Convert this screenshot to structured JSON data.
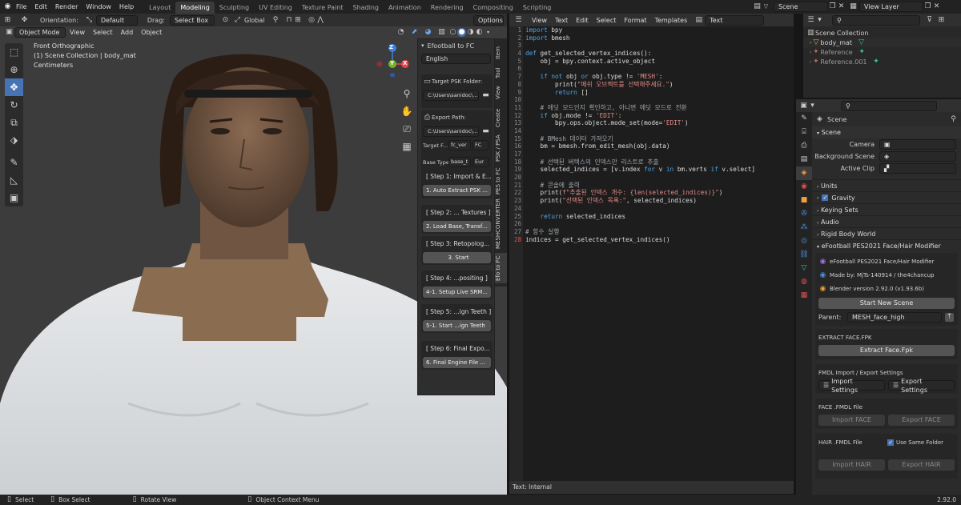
{
  "topbar": {
    "menus": [
      "File",
      "Edit",
      "Render",
      "Window",
      "Help"
    ],
    "workspaces": [
      "Layout",
      "Modeling",
      "Sculpting",
      "UV Editing",
      "Texture Paint",
      "Shading",
      "Animation",
      "Rendering",
      "Compositing",
      "Scripting"
    ],
    "active_workspace": "Modeling",
    "scene_label": "Scene",
    "view_layer_label": "View Layer"
  },
  "viewport": {
    "orientation_label": "Orientation:",
    "orientation_value": "Default",
    "drag_label": "Drag:",
    "drag_value": "Select Box",
    "transform_value": "Global",
    "options_label": "Options",
    "mode": "Object Mode",
    "menus": [
      "View",
      "Select",
      "Add",
      "Object"
    ],
    "info_line1": "Front Orthographic",
    "info_line2": "(1) Scene Collection | body_mat",
    "info_line3": "Centimeters",
    "gizmo_z": "Z",
    "gizmo_x": "X",
    "gizmo_y": "Y"
  },
  "npanel": {
    "title": "Efootball to FC",
    "language": "English",
    "target_psk_label": "Target PSK Folder:",
    "target_psk_value": "C:\\Users\\sanidoc\\...",
    "export_path_label": "Export Path:",
    "export_path_value": "C:\\Users\\sanidoc\\...",
    "target_f_label": "Target F...",
    "target_f_value": "fc_ver",
    "target_f_value2": "FC",
    "base_type_label": "Base Type:",
    "base_type_value": "base_t",
    "base_type_value2": "Eur",
    "steps": [
      {
        "label": "[ Step 1: Import & E...",
        "button": "1. Auto Extract PSK ..."
      },
      {
        "label": "[ Step 2: ... Textures ]",
        "button": "2. Load Base, Transf..."
      },
      {
        "label": "[ Step 3: Retopolog...",
        "button": "3. Start"
      },
      {
        "label": "[ Step 4: ...positing ]",
        "button": "4-1. Setup Live SRM..."
      },
      {
        "label": "[ Step 5: ...ign Teeth ]",
        "button": "5-1. Start ...ign Teeth"
      },
      {
        "label": "[ Step 6: Final Expo...",
        "button": "6. Final Engine File ..."
      }
    ],
    "tabs": [
      "Item",
      "Tool",
      "View",
      "Create",
      "PSK / PSA",
      "PES to FC",
      "MESHCONVERTER",
      "Efo to FC"
    ]
  },
  "texteditor": {
    "menus": [
      "View",
      "Text",
      "Edit",
      "Select",
      "Format",
      "Templates"
    ],
    "file_name": "Text",
    "footer": "Text: Internal",
    "line_count": 28,
    "lines": [
      "import bpy",
      "import bmesh",
      "",
      "def get_selected_vertex_indices():",
      "    obj = bpy.context.active_object",
      "",
      "    if not obj or obj.type != 'MESH':",
      "        print(\"메쉬 오브젝트를 선택해주세요.\")",
      "        return []",
      "",
      "    # 에딧 모드인지 확인하고, 아니면 에딧 모드로 전환",
      "    if obj.mode != 'EDIT':",
      "        bpy.ops.object.mode_set(mode='EDIT')",
      "",
      "    # BMesh 데이터 가져오기",
      "    bm = bmesh.from_edit_mesh(obj.data)",
      "",
      "    # 선택된 버텍스의 인덱스만 리스트로 추출",
      "    selected_indices = [v.index for v in bm.verts if v.select]",
      "",
      "    # 콘솔에 출력",
      "    print(f\"추출된 인덱스 개수: {len(selected_indices)}\")",
      "    print(\"선택된 인덱스 목록:\", selected_indices)",
      "",
      "    return selected_indices",
      "",
      "# 함수 실행",
      "indices = get_selected_vertex_indices()"
    ]
  },
  "outliner": {
    "root": "Scene Collection",
    "items": [
      "body_mat",
      "Reference",
      "Reference.001"
    ]
  },
  "properties": {
    "scene_name": "Scene",
    "scene_section": "Scene",
    "camera_label": "Camera",
    "background_label": "Background Scene",
    "clip_label": "Active Clip",
    "sections": [
      "Units",
      "Gravity",
      "Keying Sets",
      "Audio",
      "Rigid Body World"
    ],
    "addon_title": "eFootball PES2021 Face/Hair Modifier",
    "addon_name": "eFootball PES2021 Face/Hair Modifier",
    "made_by": "Made by: MjTs-140914 / the4chancup",
    "blender_version": "Blender version 2.92.0 (v1.93.6b)",
    "start_new_scene": "Start New Scene",
    "parent_label": "Parent:",
    "parent_value": "MESH_face_high",
    "extract_face_header": "EXTRACT FACE.FPK",
    "extract_face_button": "Extract Face.Fpk",
    "fmdl_header": "FMDL Import / Export Settings",
    "import_settings": "Import Settings",
    "export_settings": "Export Settings",
    "face_fmdl_header": "FACE .FMDL File",
    "import_face": "Import FACE",
    "export_face": "Export FACE",
    "hair_fmdl_header": "HAIR .FMDL File",
    "use_same_folder": "Use Same Folder",
    "import_hair": "Import HAIR",
    "export_hair": "Export HAIR"
  },
  "statusbar": {
    "select": "Select",
    "box_select": "Box Select",
    "rotate_view": "Rotate View",
    "context_menu": "Object Context Menu",
    "version": "2.92.0"
  },
  "colors": {
    "accent": "#4772b3",
    "gizmo_x": "#e8424e",
    "gizmo_y": "#75b52a",
    "gizmo_z": "#3a82e2"
  }
}
